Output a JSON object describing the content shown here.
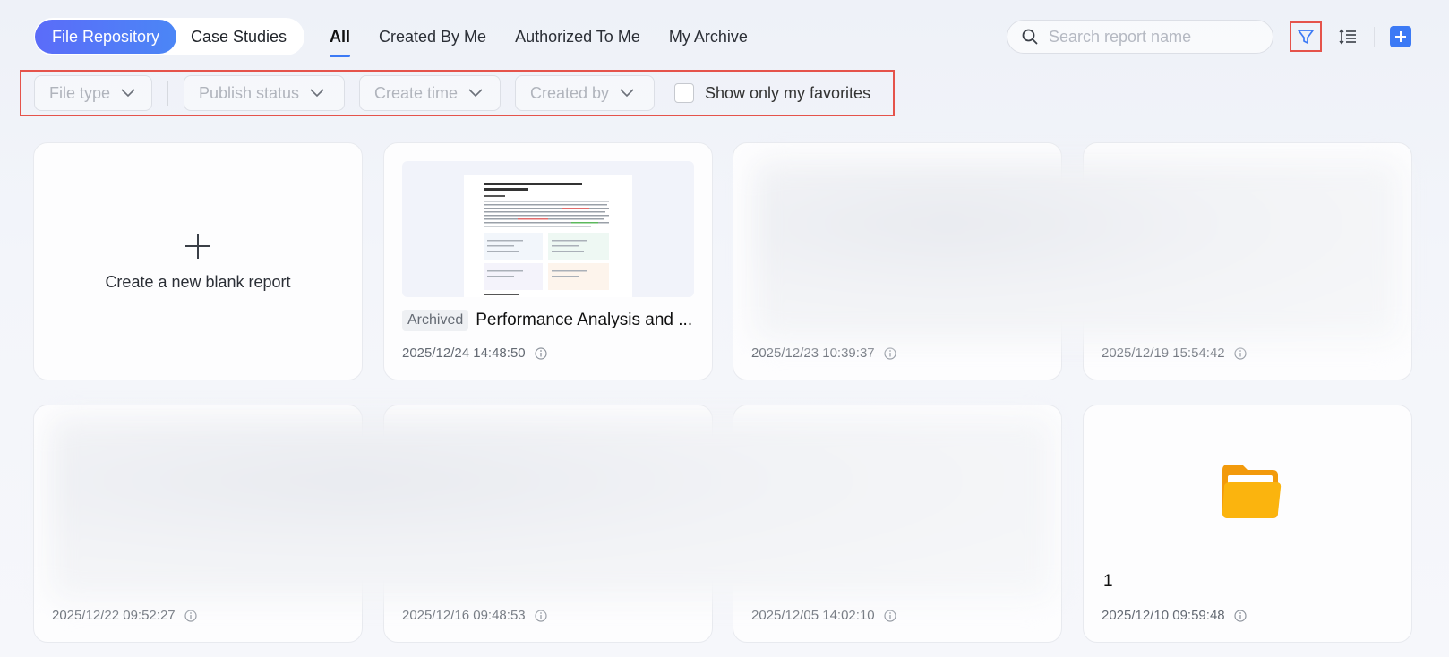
{
  "header": {
    "segments": [
      {
        "label": "File Repository",
        "active": true
      },
      {
        "label": "Case Studies",
        "active": false
      }
    ],
    "tabs": [
      {
        "label": "All",
        "active": true
      },
      {
        "label": "Created By Me"
      },
      {
        "label": "Authorized To Me"
      },
      {
        "label": "My Archive"
      }
    ],
    "search": {
      "placeholder": "Search report name",
      "value": ""
    },
    "icons": {
      "filter": "filter-icon",
      "sort": "sort-icon",
      "add": "add-icon"
    },
    "accent_color": "#3c7af5"
  },
  "filters": {
    "file_type": "File type",
    "publish_status": "Publish status",
    "create_time": "Create time",
    "created_by": "Created by",
    "favorites_label": "Show only my favorites",
    "favorites_checked": false
  },
  "new_report": {
    "label": "Create a new blank report"
  },
  "cards": [
    {
      "badge": "Archived",
      "title": "Performance Analysis and ...",
      "date": "2025/12/24 14:48:50"
    },
    {
      "title": "",
      "date": "2025/12/23 10:39:37"
    },
    {
      "title": "",
      "date": "2025/12/19 15:54:42"
    },
    {
      "title": "",
      "date": "2025/12/22 09:52:27"
    },
    {
      "title": "",
      "date": "2025/12/16 09:48:53"
    },
    {
      "title": "",
      "date": "2025/12/05 14:02:10"
    },
    {
      "type": "folder",
      "title": "1",
      "date": "2025/12/10 09:59:48",
      "icon": "folder-icon",
      "folder_color": "#fbb40e"
    }
  ]
}
